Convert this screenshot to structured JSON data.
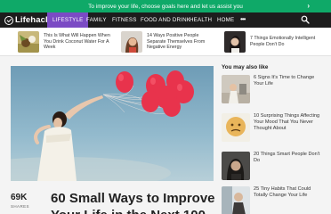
{
  "promo": {
    "text": "To improve your life, choose goals here and let us assist you",
    "arrow": "›"
  },
  "brand": {
    "name": "Lifehack",
    "accent": "#7b4bc4",
    "promo_color": "#0fa968"
  },
  "nav": {
    "items": [
      {
        "label": "LIFESTYLE",
        "active": true
      },
      {
        "label": "FAMILY",
        "active": false
      },
      {
        "label": "FITNESS",
        "active": false
      },
      {
        "label": "FOOD AND DRINK",
        "active": false
      },
      {
        "label": "HEALTH",
        "active": false
      },
      {
        "label": "HOME",
        "active": false
      }
    ],
    "more_icon": "more-dots-icon",
    "search_icon": "search-icon"
  },
  "related": [
    {
      "title": "This Is What Will Happen When You Drink Coconut Water For A Week"
    },
    {
      "title": "14 Ways Positive People Separate Themselves From Negative Energy"
    },
    {
      "title": "7 Things Emotionally Intelligent People Don't Do"
    }
  ],
  "article": {
    "shares_count": "69K",
    "shares_label": "SHARES",
    "title_line1": "60 Small Ways to Improve",
    "title_line2": "Your Life in the Next 100"
  },
  "sidebar": {
    "title": "You may also like",
    "items": [
      {
        "title": "6 Signs It's Time to Change Your Life"
      },
      {
        "title": "10 Surprising Things Affecting Your Mood That You Never Thought About"
      },
      {
        "title": "20 Things Smart People Don't Do"
      },
      {
        "title": "25 Tiny Habits That Could Totally Change Your Life"
      }
    ]
  }
}
